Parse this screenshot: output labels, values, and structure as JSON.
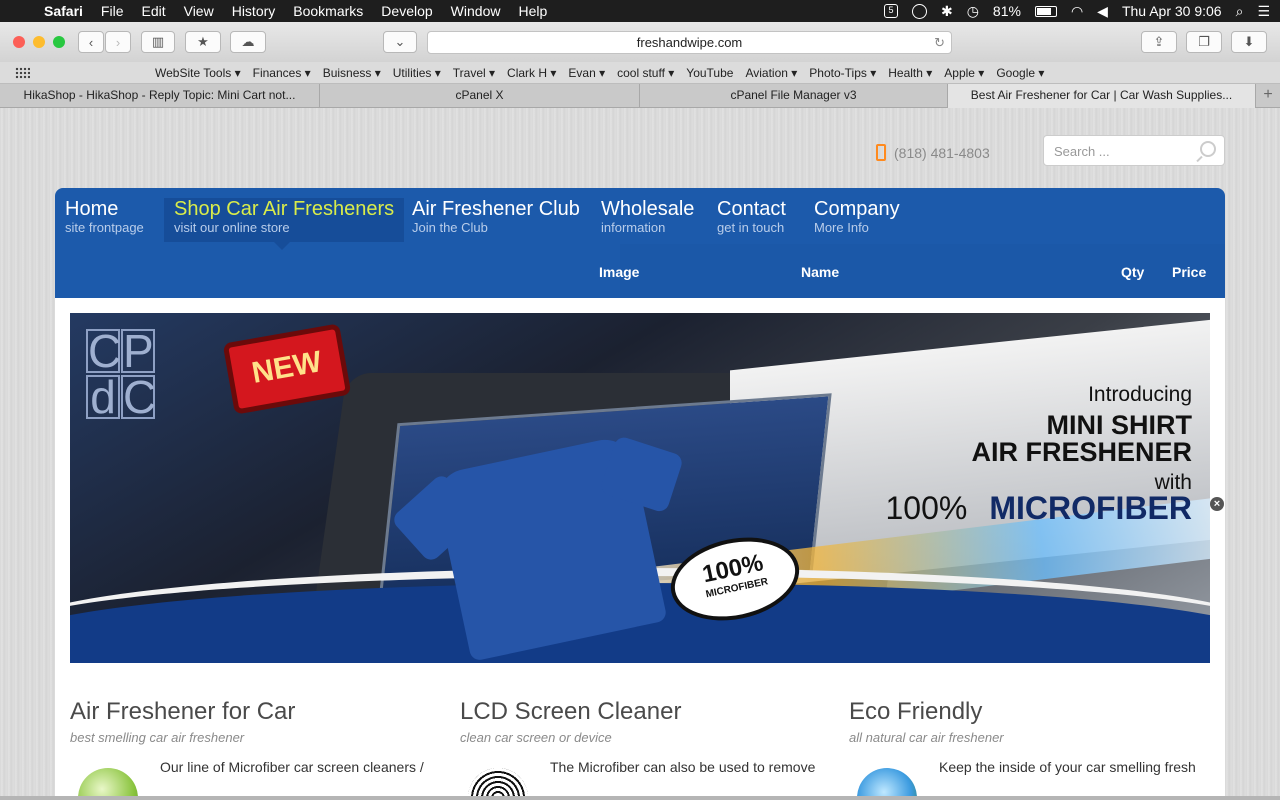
{
  "menubar": {
    "app": "Safari",
    "items": [
      "File",
      "Edit",
      "View",
      "History",
      "Bookmarks",
      "Develop",
      "Window",
      "Help"
    ],
    "status": {
      "badge": "5",
      "battery": "81%",
      "datetime": "Thu Apr 30  9:06"
    }
  },
  "toolbar": {
    "url": "freshandwipe.com"
  },
  "bookmarks": [
    "WebSite Tools ▾",
    "Finances ▾",
    "Buisness ▾",
    "Utilities ▾",
    "Travel ▾",
    "Clark H ▾",
    "Evan ▾",
    "cool stuff ▾",
    "YouTube",
    "Aviation ▾",
    "Photo-Tips ▾",
    "Health ▾",
    "Apple ▾",
    "Google ▾"
  ],
  "tabs": [
    "HikaShop - HikaShop - Reply Topic: Mini Cart not...",
    "cPanel X",
    "cPanel File Manager v3",
    "Best Air Freshener for Car | Car Wash Supplies..."
  ],
  "site": {
    "phone": "(818) 481-4803",
    "search_placeholder": "Search ...",
    "nav": [
      {
        "title": "Home",
        "sub": "site frontpage"
      },
      {
        "title": "Shop Car Air Fresheners",
        "sub": "visit our online store"
      },
      {
        "title": "Air Freshener Club",
        "sub": "Join the Club"
      },
      {
        "title": "Wholesale",
        "sub": "information"
      },
      {
        "title": "Contact",
        "sub": "get in touch"
      },
      {
        "title": "Company",
        "sub": "More Info"
      }
    ],
    "cart_header": {
      "image": "Image",
      "name": "Name",
      "qty": "Qty",
      "price": "Price"
    },
    "banner": {
      "logo_letters": [
        "C",
        "P",
        "d",
        "C"
      ],
      "badge": "NEW",
      "line1": "Introducing",
      "line2": "MINI SHIRT",
      "line3": "AIR FRESHENER",
      "line4": "with",
      "line5a": "100%",
      "line5b": "MICROFIBER",
      "stamp1": "100%",
      "stamp2": "MICROFIBER"
    },
    "features": [
      {
        "title": "Air Freshener for Car",
        "sub": "best smelling car air freshener",
        "body": "Our line of Microfiber car screen cleaners /"
      },
      {
        "title": "LCD Screen Cleaner",
        "sub": "clean car screen or device",
        "body": "The Microfiber can also be used to remove"
      },
      {
        "title": "Eco Friendly",
        "sub": "all natural car air freshener",
        "body": "Keep the inside of your car smelling fresh"
      }
    ]
  }
}
